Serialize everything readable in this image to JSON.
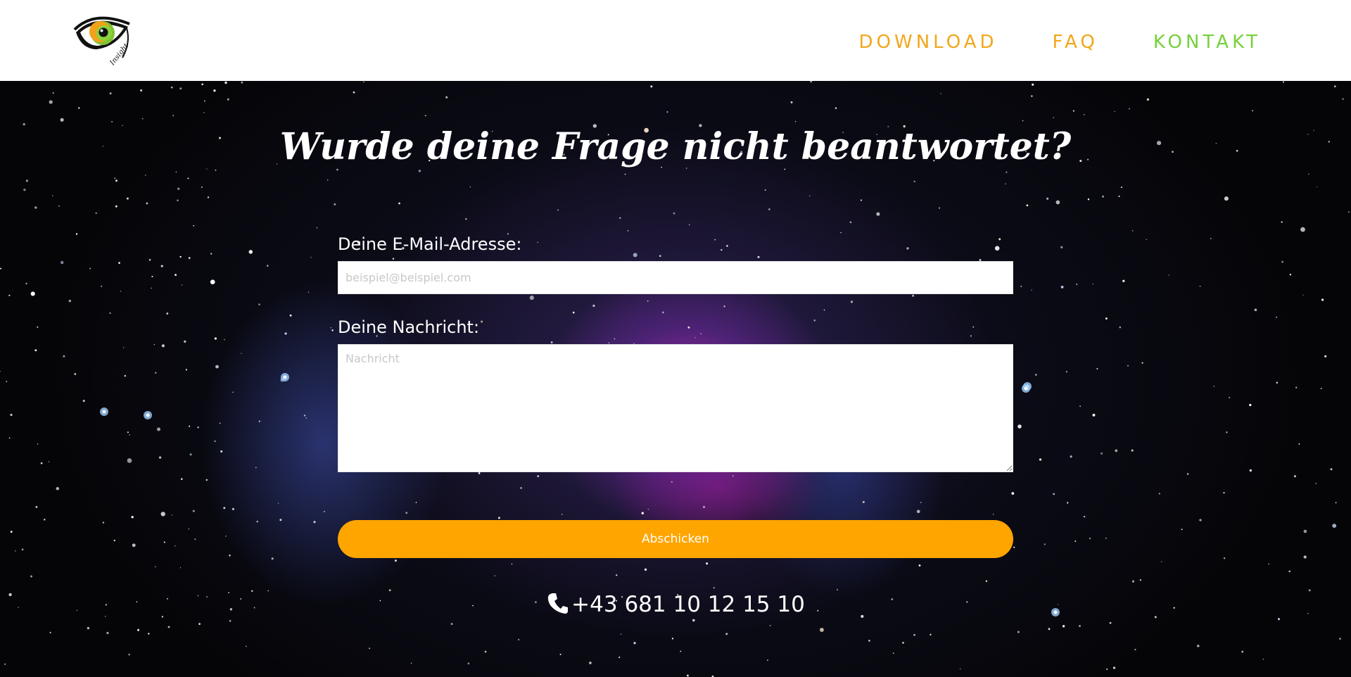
{
  "header": {
    "logo_text": "Insight",
    "nav": [
      {
        "label": "DOWNLOAD",
        "color": "#f2a71b"
      },
      {
        "label": "FAQ",
        "color": "#f2a71b"
      },
      {
        "label": "KONTAKT",
        "color": "#76d13b"
      }
    ]
  },
  "contact": {
    "headline": "Wurde deine Frage nicht beantwortet?",
    "email_label": "Deine E-Mail-Adresse:",
    "email_placeholder": "beispiel@beispiel.com",
    "message_label": "Deine Nachricht:",
    "message_placeholder": "Nachricht",
    "submit_label": "Abschicken",
    "phone": "+43 681 10 12 15 10",
    "phone_icon": "phone-icon"
  },
  "colors": {
    "accent_orange": "#ffa500",
    "accent_green": "#76d13b"
  }
}
